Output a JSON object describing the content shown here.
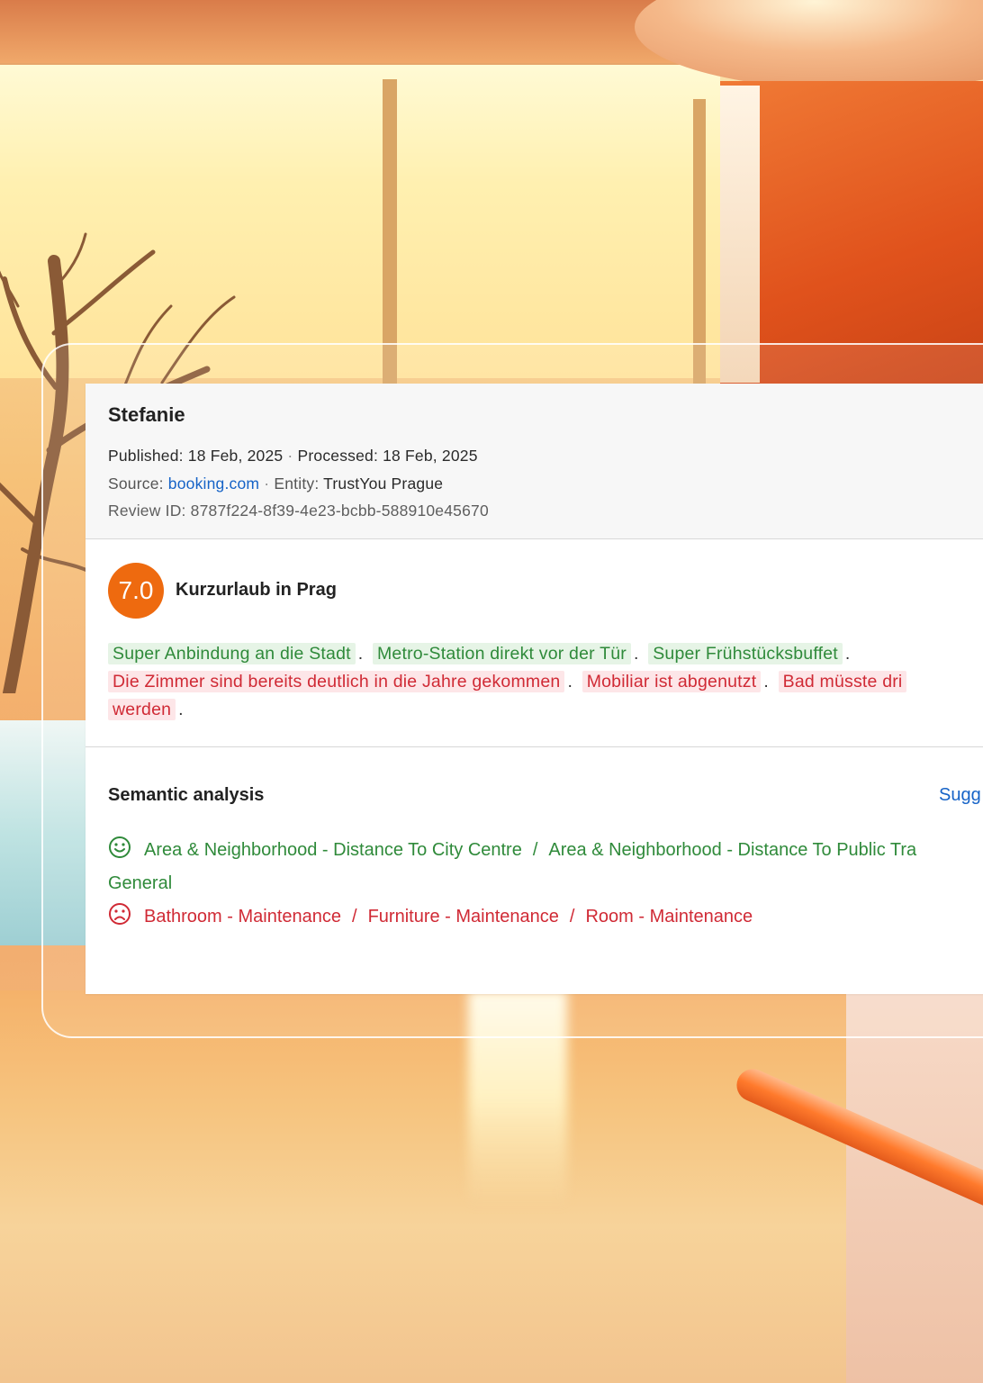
{
  "review": {
    "reviewer": "Stefanie",
    "published_label": "Published: 18 Feb, 2025",
    "processed_label": "Processed: 18 Feb, 2025",
    "source_label": "Source:",
    "source_value": "booking.com",
    "entity_label": "Entity:",
    "entity_value": "TrustYou Prague",
    "review_id_label": "Review ID:",
    "review_id_value": "8787f224-8f39-4e23-bcbb-588910e45670",
    "score": "7.0",
    "title": "Kurzurlaub in Prag",
    "positive_snippets": [
      "Super Anbindung an die Stadt",
      "Metro-Station direkt vor der Tür",
      "Super Frühstücksbuffet"
    ],
    "negative_snippets": [
      "Die Zimmer sind bereits deutlich in die Jahre gekommen",
      "Mobiliar ist abgenutzt",
      "Bad müsste dri",
      "werden"
    ]
  },
  "semantic": {
    "title": "Semantic analysis",
    "suggest_link": "Sugg",
    "positive_topics": [
      "Area & Neighborhood - Distance To City Centre",
      "Area & Neighborhood - Distance To Public Tra"
    ],
    "positive_topics_wrap": "General",
    "negative_topics": [
      "Bathroom - Maintenance",
      "Furniture - Maintenance",
      "Room - Maintenance"
    ]
  },
  "colors": {
    "score_badge": "#ee6a0f",
    "positive_text": "#2f8a3a",
    "positive_bg": "#e6f4e6",
    "negative_text": "#d02a35",
    "negative_bg": "#fde6e8",
    "link": "#1663c7"
  },
  "icons": {
    "positive": "smiley-face-icon",
    "negative": "sad-face-icon"
  }
}
